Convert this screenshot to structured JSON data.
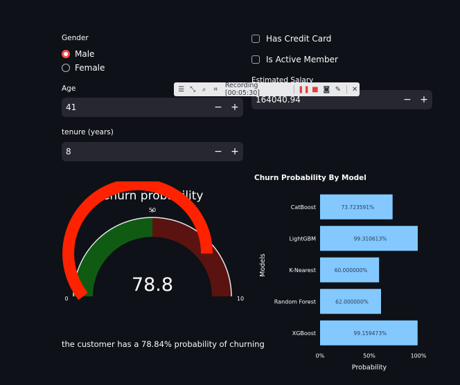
{
  "gender": {
    "label": "Gender",
    "options": [
      {
        "label": "Male",
        "selected": true
      },
      {
        "label": "Female",
        "selected": false
      }
    ]
  },
  "age": {
    "label": "Age",
    "value": "41"
  },
  "tenure": {
    "label": "tenure (years)",
    "value": "8"
  },
  "has_credit_card": {
    "label": "Has Credit Card",
    "checked": false
  },
  "is_active_member": {
    "label": "Is Active Member",
    "checked": false
  },
  "salary": {
    "label": "Estimated Salary",
    "value": "164040.94"
  },
  "stepper": {
    "minus": "−",
    "plus": "+"
  },
  "recording_toolbar": {
    "status": "Recording [00:05:30]"
  },
  "gauge": {
    "title": "Churn probability",
    "value": 78.8,
    "value_label": "78.8",
    "min_label": "0",
    "mid_label": "50",
    "max_label": "10",
    "colors": {
      "bar": "#ff2200",
      "low_band": "#0f5b13",
      "high_band": "#5a1310",
      "track": "#2a1518"
    }
  },
  "result_text": "the customer has a 78.84% probability of churning",
  "chart_data": {
    "type": "bar",
    "orientation": "horizontal",
    "title": "Churn Probability By Model",
    "xlabel": "Probability",
    "ylabel": "Models",
    "xlim": [
      0,
      1
    ],
    "categories": [
      "CatBoost",
      "LightGBM",
      "K-Nearest",
      "Random Forest",
      "XGBoost"
    ],
    "values": [
      0.73723591,
      0.99310613,
      0.6,
      0.62,
      0.99159473
    ],
    "data_labels": [
      "73.723591%",
      "99.310613%",
      "60.000000%",
      "62.000000%",
      "99.159473%"
    ],
    "x_ticks": [
      "0%",
      "50%",
      "100%"
    ],
    "bar_color": "#83c9ff"
  }
}
